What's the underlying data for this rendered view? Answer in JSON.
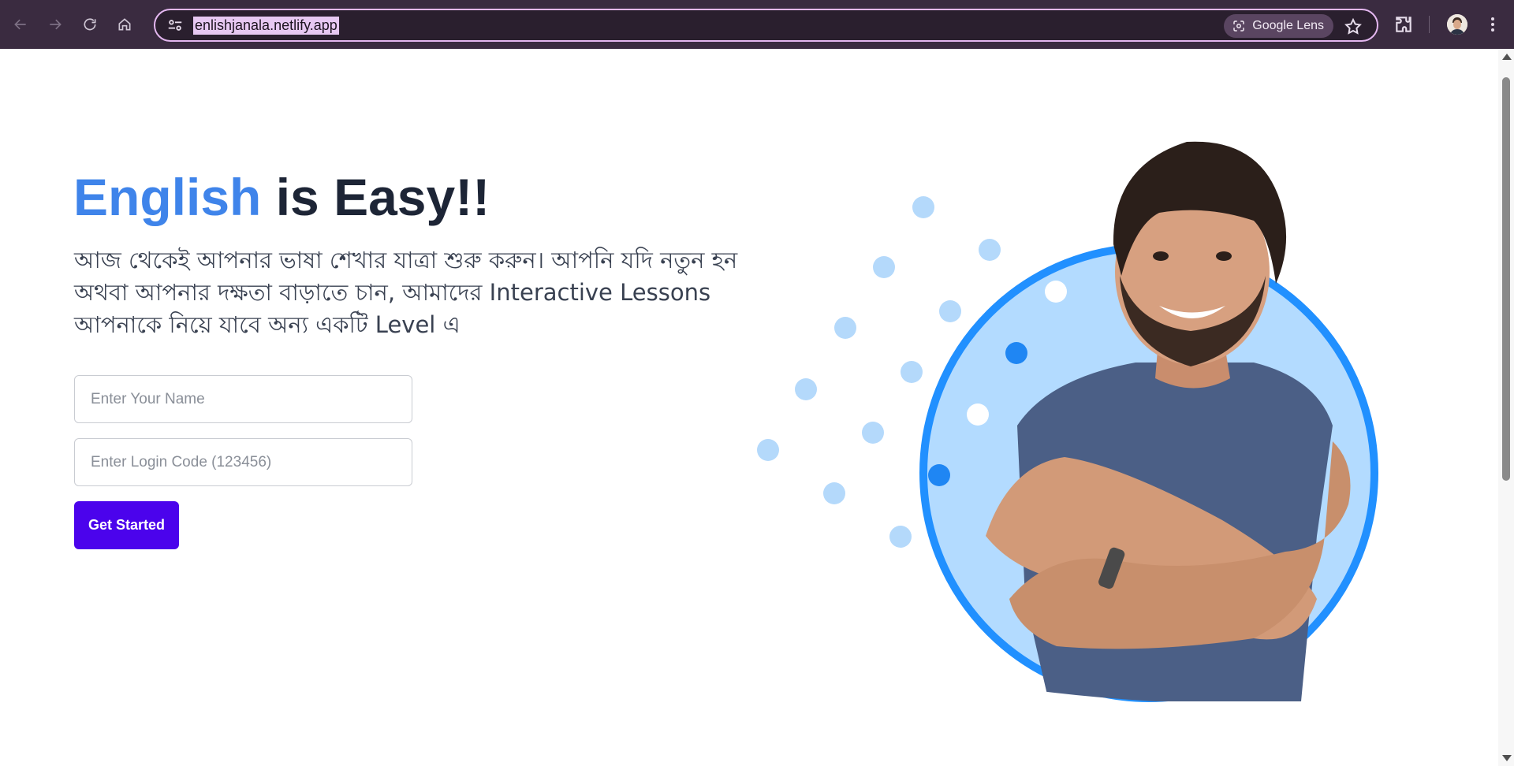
{
  "browser": {
    "url": "enlishjanala.netlify.app",
    "lens_label": "Google Lens",
    "icons": {
      "back": "arrow-left-icon",
      "forward": "arrow-right-icon",
      "reload": "reload-icon",
      "home": "home-icon",
      "site_info": "tune-icon",
      "lens": "lens-icon",
      "bookmark": "star-icon",
      "extensions": "puzzle-icon",
      "profile": "avatar",
      "menu": "kebab-menu-icon"
    }
  },
  "hero": {
    "title_accent": "English",
    "title_rest": " is Easy!!",
    "subtitle": "আজ থেকেই আপনার ভাষা শেখার যাত্রা শুরু করুন। আপনি যদি নতুন হন অথবা আপনার দক্ষতা বাড়াতে চান, আমাদের Interactive Lessons আপনাকে নিয়ে যাবে অন্য একটি Level এ",
    "accent_color": "#3f84ea",
    "text_color": "#1d2536"
  },
  "form": {
    "name_placeholder": "Enter Your Name",
    "name_value": "",
    "code_placeholder": "Enter Login Code (123456)",
    "code_value": "",
    "submit_label": "Get Started",
    "button_color": "#4b03ec"
  },
  "illustration": {
    "subject": "smiling man with crossed arms",
    "circle_color": "#2190ff",
    "circle_fill": "#b3dbff"
  }
}
